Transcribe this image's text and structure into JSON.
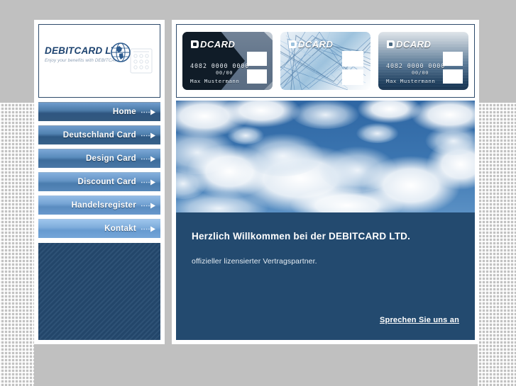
{
  "brand": {
    "logo_title": "DEBITCARD LTD.",
    "logo_tagline": "Enjoy your benefits with DEBITCARD",
    "accent_dark": "#234a6f",
    "accent_mid": "#4a7cae",
    "accent_light": "#9ec5ec",
    "page_bg": "#c0c0c0"
  },
  "sidebar": {
    "items": [
      {
        "label": "Home"
      },
      {
        "label": "Deutschland Card"
      },
      {
        "label": "Design Card"
      },
      {
        "label": "Discount Card"
      },
      {
        "label": "Handelsregister"
      },
      {
        "label": "Kontakt"
      }
    ],
    "arrow_icon": "dotted-arrow-right-icon"
  },
  "cards": [
    {
      "brand": "DCARD",
      "number": "4082  0000  0000",
      "expiry": "00/00",
      "holder": "Max Mustermann",
      "style": "chevron-dark"
    },
    {
      "brand": "DCARD",
      "number": "",
      "expiry": "",
      "holder": "",
      "style": "abstract-blue"
    },
    {
      "brand": "DCARD",
      "number": "4082  0000  0000",
      "expiry": "00/00",
      "holder": "Max Mustermann",
      "style": "gradient-navy"
    }
  ],
  "hero": {
    "alt": "sky-clouds-banner"
  },
  "welcome": {
    "title": "Herzlich Willkommen bei der DEBITCARD LTD.",
    "subtitle": "offizieller lizensierter Vertragspartner.",
    "link": "Sprechen Sie uns an"
  }
}
